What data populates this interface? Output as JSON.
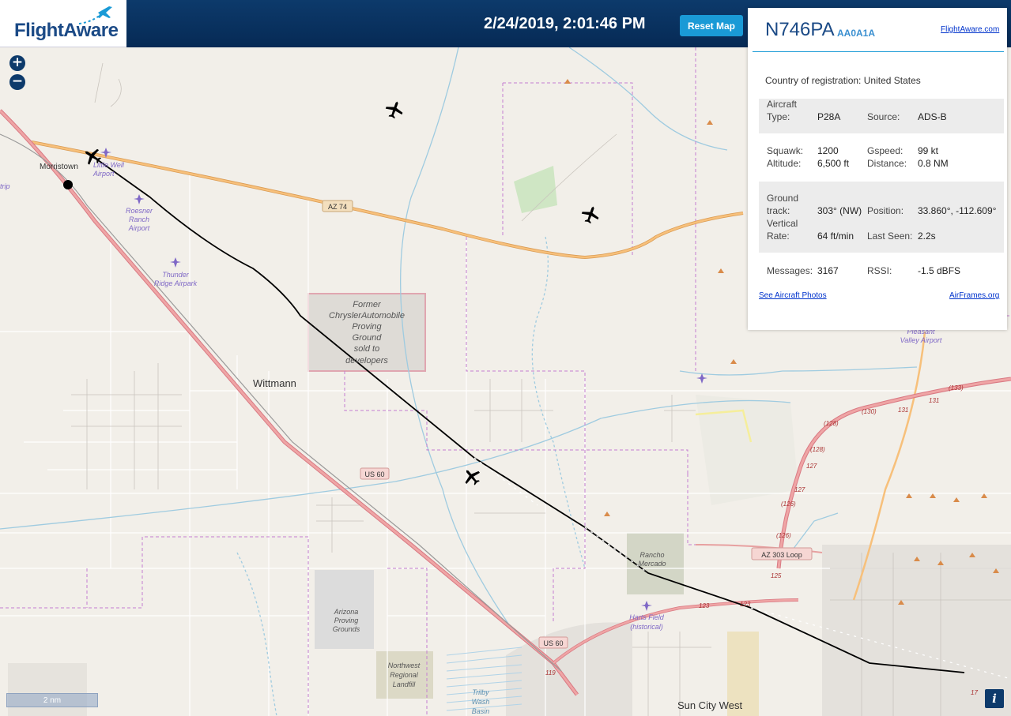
{
  "header": {
    "logo_text": "FlightAware",
    "datetime": "2/24/2019, 2:01:46 PM",
    "reset_label": "Reset Map"
  },
  "map": {
    "labels": {
      "morristown": "Morristown",
      "little_well": [
        "Little Well",
        "Airport"
      ],
      "roesner": [
        "Roesner",
        "Ranch",
        "Airport"
      ],
      "thunder_ridge": [
        "Thunder",
        "Ridge Airpark"
      ],
      "chrysler": [
        "Former",
        "ChryslerAutomobile",
        "Proving",
        "Ground",
        "sold to",
        "developers"
      ],
      "wittmann": "Wittmann",
      "az74": "AZ 74",
      "us60_a": "US 60",
      "us60_b": "US 60",
      "az303": "AZ 303 Loop",
      "arizona_pg": [
        "Arizona",
        "Proving",
        "Grounds"
      ],
      "landfill": [
        "Northwest",
        "Regional",
        "Landfill"
      ],
      "rancho": [
        "Rancho",
        "Mercado"
      ],
      "harts": [
        "Harts Field",
        "(historical)"
      ],
      "trilby": [
        "Trilby",
        "Wash",
        "Basin"
      ],
      "sun_city_west": "Sun City West",
      "pleasant_valley": [
        "Pleasant",
        "Valley Airport"
      ],
      "strip": "trip",
      "road_numbers": [
        "(133)",
        "(130)",
        "131",
        "131",
        "(128)",
        "(128)",
        "127",
        "127",
        "(126)",
        "(126)",
        "125",
        "123",
        "123",
        "119",
        "17"
      ]
    },
    "scale_label": "2 nm",
    "info_icon": "i"
  },
  "panel": {
    "ident": "N746PA",
    "hex": "AA0A1A",
    "fa_link": "FlightAware.com",
    "country_label": "Country of registration:",
    "country_value": "United States",
    "aircraft_type_label": [
      "Aircraft",
      "Type:"
    ],
    "aircraft_type": "P28A",
    "source_label": "Source:",
    "source": "ADS-B",
    "squawk_label": "Squawk:",
    "squawk": "1200",
    "gspeed_label": "Gspeed:",
    "gspeed": "99 kt",
    "altitude_label": "Altitude:",
    "altitude": "6,500 ft",
    "distance_label": "Distance:",
    "distance": "0.8 NM",
    "ground_track_label": [
      "Ground",
      "track:"
    ],
    "ground_track": "303° (NW)",
    "position_label": "Position:",
    "position": "33.860°, -112.609°",
    "vertical_rate_label": [
      "Vertical",
      "Rate:"
    ],
    "vertical_rate": "64 ft/min",
    "last_seen_label": "Last Seen:",
    "last_seen": "2.2s",
    "messages_label": "Messages:",
    "messages": "3167",
    "rssi_label": "RSSI:",
    "rssi": "-1.5 dBFS",
    "photos_link": "See Aircraft Photos",
    "airframes_link": "AirFrames.org"
  },
  "colors": {
    "header_bg": "#062a55",
    "accent": "#1a9ad6",
    "track": "#000000",
    "highway": "#e78a8a",
    "state_road": "#f2b668",
    "boundary": "#c47ed1",
    "water": "#9fcbe0"
  }
}
